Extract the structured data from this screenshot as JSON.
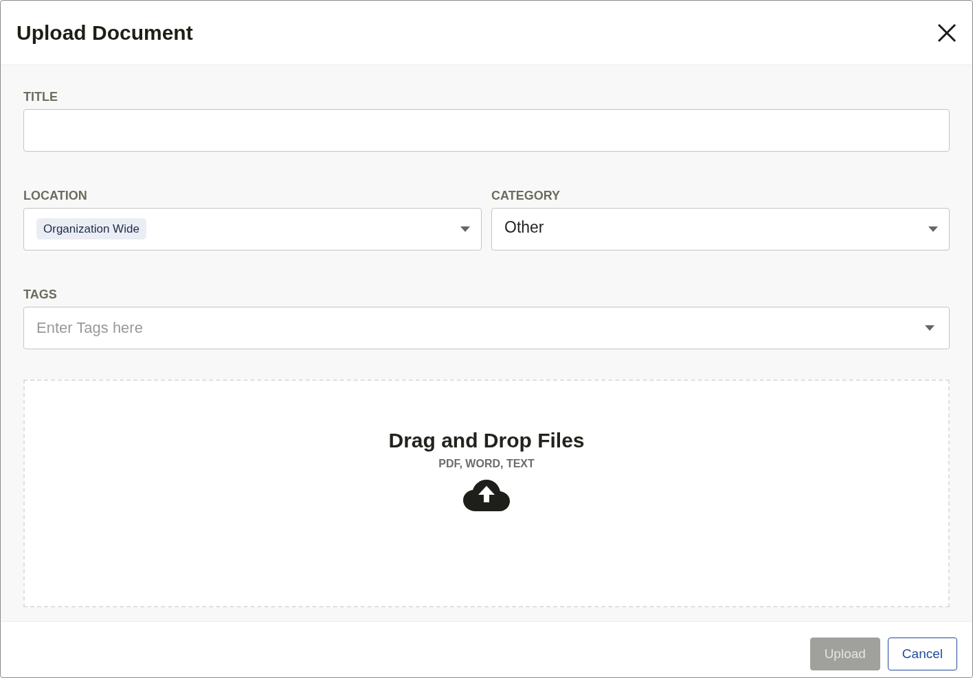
{
  "dialog": {
    "title": "Upload Document"
  },
  "fields": {
    "title": {
      "label": "TITLE"
    },
    "location": {
      "label": "LOCATION",
      "chips": [
        "Organization Wide"
      ]
    },
    "category": {
      "label": "CATEGORY",
      "value": "Other"
    },
    "tags": {
      "label": "TAGS",
      "placeholder": "Enter Tags here"
    }
  },
  "dropzone": {
    "heading": "Drag and Drop Files",
    "formats": "PDF, WORD, TEXT"
  },
  "buttons": [
    {
      "label": "Upload",
      "kind": "primary",
      "disabled": true
    },
    {
      "label": "Cancel",
      "kind": "secondary",
      "disabled": false
    }
  ]
}
